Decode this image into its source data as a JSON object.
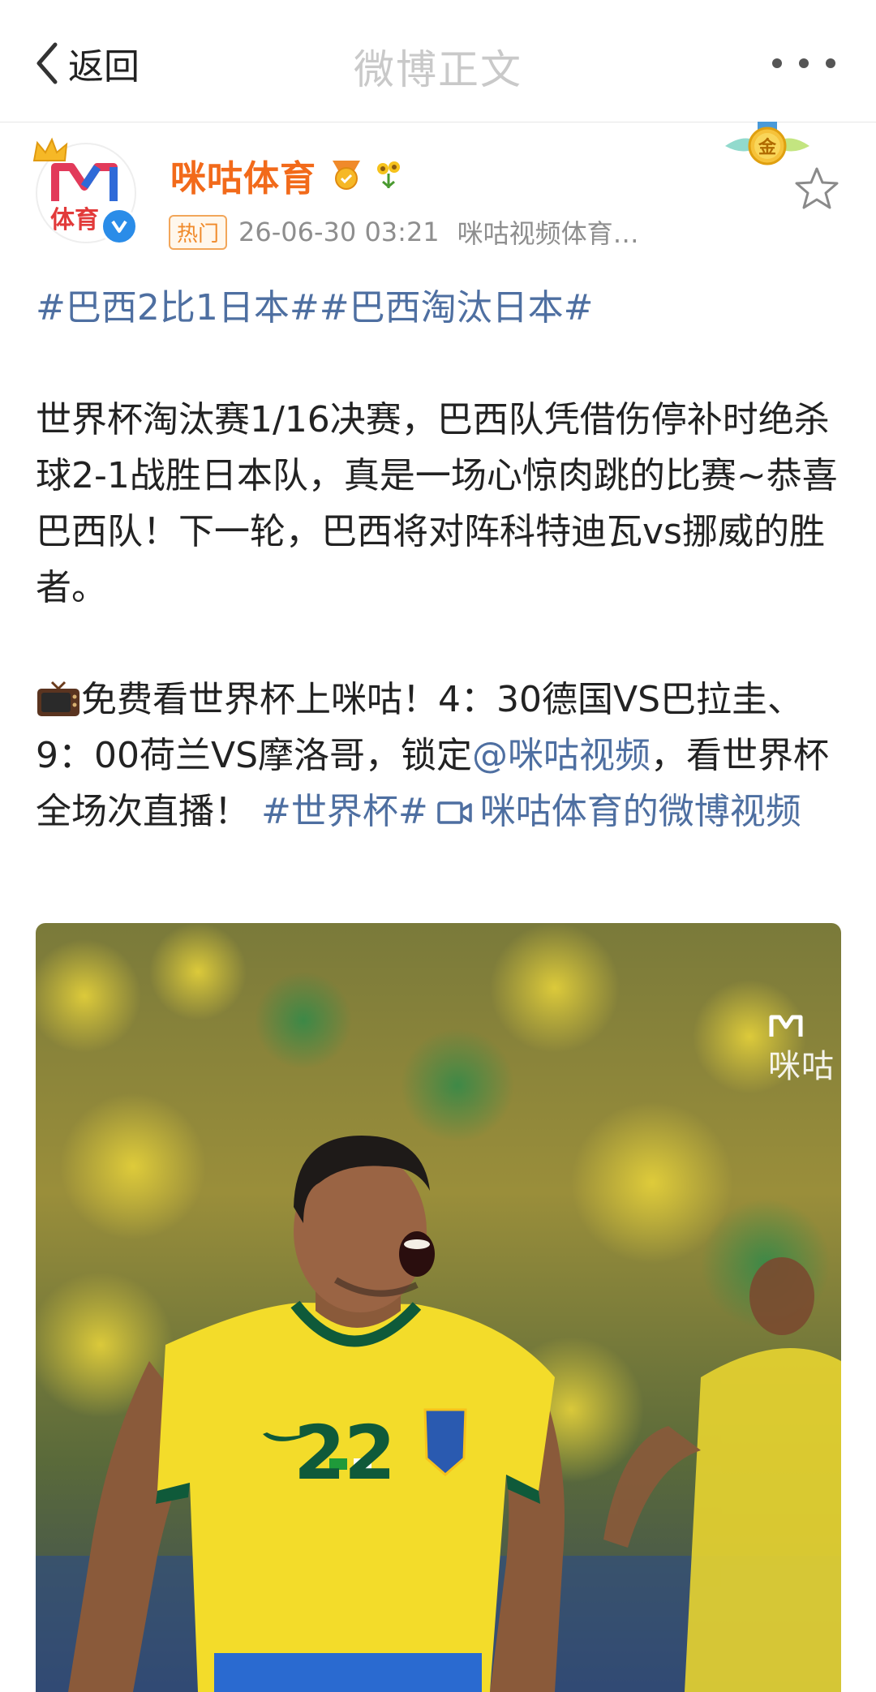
{
  "nav": {
    "back_label": "返回",
    "title": "微博正文"
  },
  "author": {
    "name": "咪咕体育",
    "avatar_text": "体育",
    "badge": "热门",
    "time": "26-06-30 03:21",
    "source": "咪咕视频体育…",
    "medal_text": "金"
  },
  "post": {
    "hashtags": "#巴西2比1日本##巴西淘汰日本#",
    "paragraph1": "世界杯淘汰赛1/16决赛，巴西队凭借伤停补时绝杀球2-1战胜日本队，真是一场心惊肉跳的比赛~恭喜巴西队！下一轮，巴西将对阵科特迪瓦vs挪威的胜者。",
    "paragraph2_text": "免费看世界杯上咪咕！4：30德国VS巴拉圭、9：00荷兰VS摩洛哥，锁定",
    "mention": "@咪咕视频",
    "paragraph2_tail": "，看世界杯全场次直播！",
    "topic": "#世界杯#",
    "video_link": "咪咕体育的微博视频"
  },
  "media": {
    "watermark": "咪咕",
    "jersey_number": "22"
  },
  "colors": {
    "link": "#4e6fa1",
    "author_name": "#f26a1a",
    "jersey_yellow": "#f3dc2a",
    "jersey_green": "#0f5a3a"
  },
  "icons": [
    "chevron-left-icon",
    "more-icon",
    "crown-icon",
    "verified-icon",
    "medal-icon",
    "flower-icon",
    "gold-medal-icon",
    "star-icon",
    "tv-icon",
    "video-icon"
  ]
}
